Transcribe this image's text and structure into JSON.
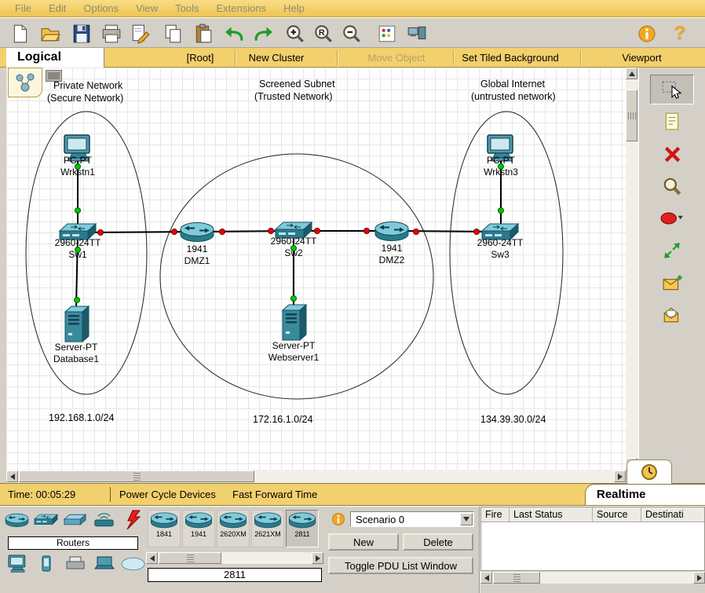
{
  "colors": {
    "accent_yellow": "#F3D06E",
    "panel_gray": "#D4D0C8",
    "device_teal": "#2B7A8C",
    "link_up_green": "#00C800",
    "link_down_red": "#EE0000",
    "shape_red": "#E02020"
  },
  "menubar": {
    "items": [
      "File",
      "Edit",
      "Options",
      "View",
      "Tools",
      "Extensions",
      "Help"
    ]
  },
  "toolbar": {
    "icons": [
      "new-file",
      "open-folder",
      "save",
      "print",
      "activity-wizard",
      "copy",
      "paste",
      "undo",
      "redo",
      "zoom-in",
      "zoom-reset",
      "zoom-out",
      "drawing-palette",
      "custom-devices-dialog",
      "info",
      "help"
    ],
    "zoom_reset_symbol": "R",
    "help_glyph": "?"
  },
  "logical_bar": {
    "mode_tab": "Logical",
    "buttons": [
      "[Root]",
      "New Cluster",
      "Move Object",
      "Set Tiled Background",
      "Viewport"
    ]
  },
  "canvas": {
    "zones": [
      {
        "title": "Private Network",
        "subtitle": "(Secure Network)"
      },
      {
        "title": "Screened Subnet",
        "subtitle": "(Trusted Network)"
      },
      {
        "title": "Global Internet",
        "subtitle": "(untrusted network)"
      }
    ],
    "devices": [
      {
        "type": "pc",
        "model": "PC-PT",
        "name": "Wrkstn1"
      },
      {
        "type": "switch",
        "model": "2960-24TT",
        "name": "Sw1"
      },
      {
        "type": "server",
        "model": "Server-PT",
        "name": "Database1"
      },
      {
        "type": "router",
        "model": "1941",
        "name": "DMZ1"
      },
      {
        "type": "switch",
        "model": "2960-24TT",
        "name": "Sw2"
      },
      {
        "type": "server",
        "model": "Server-PT",
        "name": "Webserver1"
      },
      {
        "type": "router",
        "model": "1941",
        "name": "DMZ2"
      },
      {
        "type": "switch",
        "model": "2960-24TT",
        "name": "Sw3"
      },
      {
        "type": "pc",
        "model": "PC-PT",
        "name": "Wrkstn3"
      }
    ],
    "subnet_labels": [
      "192.168.1.0/24",
      "172.16.1.0/24",
      "134.39.30.0/24"
    ]
  },
  "side_tools": {
    "items": [
      "select",
      "place-note",
      "delete",
      "inspect",
      "draw-shape",
      "resize-shape",
      "add-simple-pdu",
      "add-complex-pdu"
    ]
  },
  "realtime_bar": {
    "time_label": "Time: 00:05:29",
    "power_cycle_label": "Power Cycle Devices",
    "fast_forward_label": "Fast Forward Time",
    "mode_label": "Realtime"
  },
  "device_palette": {
    "category_label": "Routers",
    "categories_row1": [
      "routers",
      "switches",
      "hubs",
      "wireless-devices",
      "connections"
    ],
    "categories_row2": [
      "end-devices",
      "phones",
      "printers",
      "laptops",
      "wan-emulation-cloud"
    ],
    "models": [
      "1841",
      "1941",
      "2620XM",
      "2621XM",
      "2811"
    ],
    "selected_model": "2811"
  },
  "scenario_panel": {
    "scenario_select": "Scenario 0",
    "new_button": "New",
    "delete_button": "Delete",
    "toggle_button": "Toggle PDU List Window"
  },
  "pdu_list": {
    "columns": [
      "Fire",
      "Last Status",
      "Source",
      "Destinati"
    ]
  }
}
